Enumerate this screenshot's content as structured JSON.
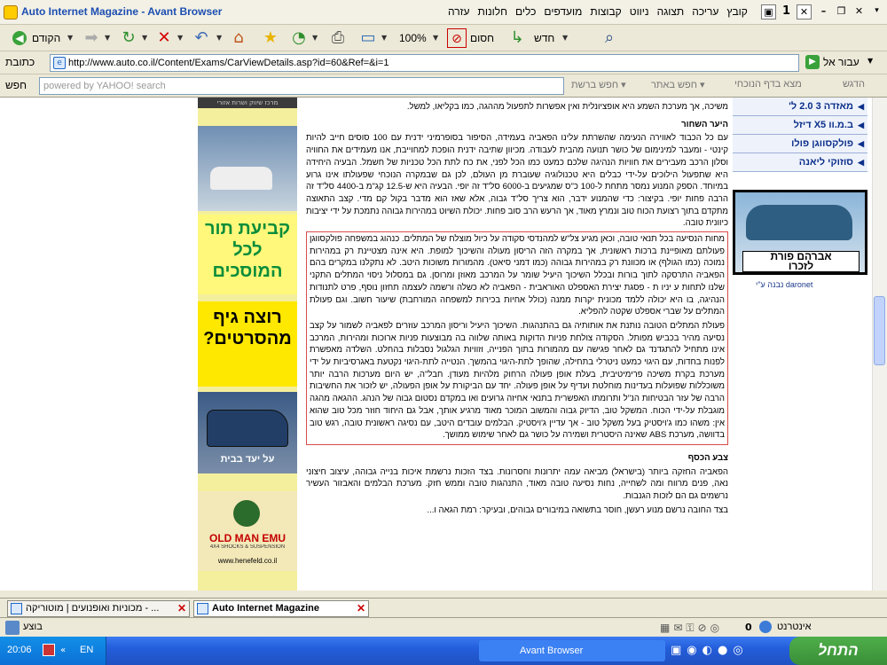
{
  "window": {
    "title": "Auto Internet Magazine - Avant Browser",
    "menu": [
      "קובץ",
      "עריכה",
      "תצוגה",
      "ניווט",
      "קבוצות",
      "מועדפים",
      "כלים",
      "חלונות",
      "עזרה"
    ],
    "window_buttons": [
      "✕",
      "❐",
      "–"
    ],
    "menu_right_buttons": [
      "1",
      "▣"
    ]
  },
  "toolbar": {
    "back_label": "הקודם",
    "zoom_label": "100%",
    "block_label": "חסום",
    "new_label": "חדש"
  },
  "address": {
    "label": "כתובת",
    "url": "http://www.auto.co.il/Content/Exams/CarViewDetails.asp?id=60&Ref=&i=1",
    "go_label": "עבור אל"
  },
  "search": {
    "label": "חפש",
    "placeholder": "powered by YAHOO! search",
    "web_search_label": "חפש ברשת",
    "site_search_label": "חפש באתר",
    "page_search_label": "מצא בדף הנוכחי",
    "highlight_label": "הדגש"
  },
  "sidebar": {
    "items": [
      "מאזדה 3 2.0 ל'",
      "ב.מ.וו X5 דיזל",
      "פולקסווגן פולו",
      "סוזוקי ליאנה"
    ]
  },
  "ad": {
    "caption_line1": "אברהם פורת",
    "caption_line2": "לזכרו",
    "sponsor": "נבנה ע\"י daronet"
  },
  "left_banners": {
    "top_strip": "מרכז שיווק ושרות אזורי",
    "queue_text": "קביעת תור לכל המוסכים",
    "gif_text": "רוצה גיף מהסרטים?",
    "oldman_text": "OLD MAN EMU",
    "oldman_sub": "4X4 SHOCKS & SUSPENSION",
    "oldman_url": "www.henefeld.co.il",
    "car_banner_text": "על יעד בבית"
  },
  "article": {
    "intro": "משיכה, אך מערכת השמע היא אופציונלית ואין אפשרות לתפעול מההגה, כמו בקליאו, למשל.",
    "section1_title": "היער השחור",
    "section1_text": "עם כל הכבוד לאווירה הנעימה שהשרתת עלינו הפאביה בעמידה, הסיפור בסופרמיני ידנית עם 100 סוסים חייב להיות קינטי - ומעבר למינימום של כושר תנועה מהבית לעבודה. מכיוון שתיבה ידנית הופכת למחוייבת, אנו מעמידים את החוויה וסלון הרכב מעבירים את חוויות הנהיגה שלכם כמעט כמו הכל לפני, את כח לתת הכל טכניות של חשמל. הבעיה היחידה היא שתפעול הילוכים על-ידי כבלים היא טכנולוגיה שעוברת מן העולם, לכן גם שבמקרה הנוכחי שפעולתו אינו גרוע במיוחד. הספק המנוע נמסר מתחת ל-100 כ\"ס שמגיעים ב-6000 סל\"ד זה יופי. הבעיה היא ש-12.5 קג\"מ ב-4400 סל\"ד זה הרבה פחות יופי. בקיצור: כדי שהמנוע ידבר, הוא צריך סל\"ד גבוה, אלא שאז הוא מדבר בקול קם מדי. קצב התאוצה מתקדם בתוך רצועת הכוח טוב ונמרץ מאוד, אך הרעש הרב סוב פחות. יכולת השיוט במהירות גבוהה נתמכת על ידי יציבות כיוונית טובה.",
    "highlight_p1": "מחות הנסיעה בכל תנאי טובה, וכאן מגיע צל\"ש למהנדסי סקודה על כיול מוצלח של המתלים. כנהוג במשפחה פולקסווגן פעולתם מאופיינת ברכות ראשונית, אך במקרה הזה הריסון מעולה והשיכוך למופת. היא אינה מצטיינת רק במהירות נמוכה (כמו הגולף) או מכוונת רק במהירות גבוהה (כמו דמני סיאט). מהמורות משוכות היטב. לא נתקלנו במקרים בהם הפאביה התרסקה לתוך בורות ובכלל השיכוך היעיל שומר על המרכב מאוזן ומרוסן. גם במסלול ניסוי המתלים התקני שלנו לתחות ע יניו ת - פסגת יצירת האספלט האוראבית - הפאביה לא כשלה ורשמה לעצמה תחזון נוסף, פרט לתנודות הנהיגה, בו היא יכולה ללמד מכונית יקרות ממנה (כולל אחיות בכירות למשפחה המורחבת) שיעור חשוב. וגם פעולת המתלים על שברי אספלט שקטה להפליא.",
    "highlight_p2": "פעולת המתלים הטובה נותנת את אותותיה גם בהתנהגות. השיכוך היעיל וריסון המרכב עוזרים לפאביה לשמור על קצב נסיעה מהיר בכביש מפותל. הסקודה צולחת פניות הדוקות באותה שלווה בה מבוצעות פניות ארוכות ומהירות, המרכב אינו מתחיל להתגדנד גם לאחר פגישה עם מהמורות בתוך הפנייה, וזוויות הגלגול נסבלות בהחלט. השלדה מאפשרת לפנות בחדות, עם היגוי כמעט ניטרלי בתחילה, שהופך לתת-היגוי בהמשך. הנטייה לתת-היגוי נקטעת באגרסיביות על ידי מערכת בקרת משיכה פרימיטיבית, בעלת אופן פעולה הרחוק מלהיות מעודן. חבל\"ה, יש היום מערכות הרבה יותר משוכללות שפועלות בעדינות מוחלטת ועדיף על אופן פעולה. יחד עם הביקורת על אופן הפעולה, יש לזכור את החשיבות הרבה של עזר הבטיחות הנ\"ל ותרומתו האפשרית בתנאי אחיזה גרועים ואו במקדם נסטום גבוה של הנהג. ההגאה מהגה מוגבלת על-ידי הכוח. המשקל טוב, הדיוק גבוה והמשוב המוכר מאוד מרגיע אותך, אבל גם היחוד חוזר מכל טוב שהוא אין: משהו כמו ג'ויסטיק בעל משקל טוב - אך עדיין ג'ויסטיק. הבלמים עובדים היטב, עם נסיגה ראשונית טובה, רגש טוב בדוושה, מערכת ABS שאינה היסטרית ושמירה על כושר גם לאחר שימוש ממושך.",
    "section2_title": "צבע הכסף",
    "section2_text": "הפאביה החזקה ביותר (בישראל) מביאה עמה יתרונות וחסרונות. בצד הזכות נרשמת איכות בנייה גבוהה, עיצוב חיצוני נאה, פנים מרווח ומה לשחייה, נחות נסיעה טובה מאוד, התנהגות טובה וממש חזק. מערכת הבלמים והאבזור העשיר נרשמים גם הם לזכות הגנבות.",
    "section2_tail": "בצד החובה נרשם מנוע רעשן, חוסר בתשואה במיבורים גבוהים, ובעיקר: רמת הגאה ו..."
  },
  "tabs": [
    {
      "label": "מכוניות ואופנועים | מוטוריקה - ..."
    },
    {
      "label": "Auto Internet Magazine"
    }
  ],
  "status": {
    "text": "בוצע",
    "zone": "אינטרנט",
    "counter": "0"
  },
  "taskbar": {
    "start_label": "התחל",
    "task_label": "Avant Browser",
    "clock": "20:06",
    "lang": "EN"
  }
}
